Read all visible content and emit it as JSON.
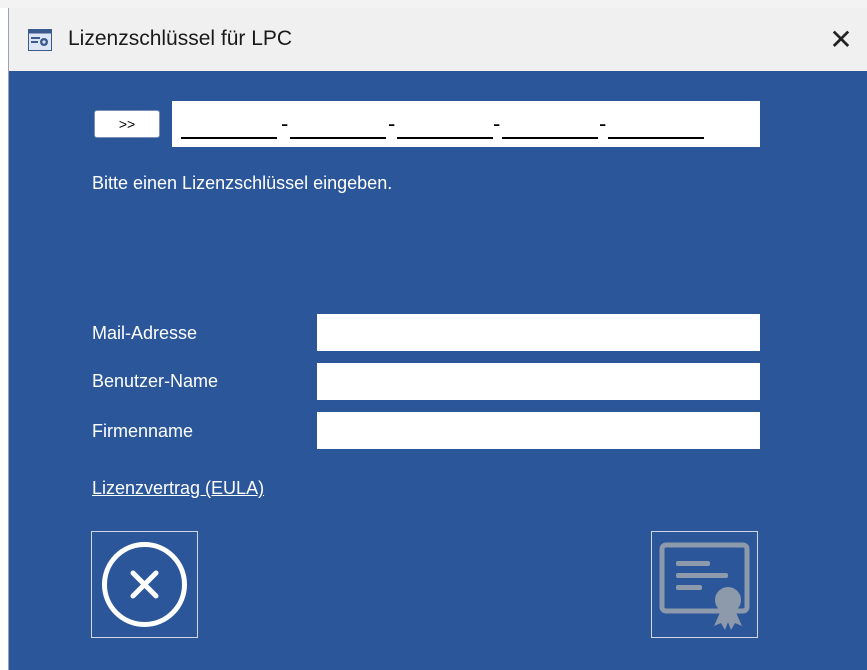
{
  "window": {
    "title": "Lizenzschlüssel für LPC",
    "close_glyph": "✕"
  },
  "license": {
    "expand_label": ">>",
    "key_value": "",
    "hint": "Bitte einen Lizenzschlüssel eingeben."
  },
  "form": {
    "mail_label": "Mail-Adresse",
    "user_label": "Benutzer-Name",
    "company_label": "Firmenname",
    "mail_value": "",
    "user_value": "",
    "company_value": ""
  },
  "eula_link": "Lizenzvertrag (EULA)",
  "icons": {
    "app": "app-license-icon",
    "cancel": "cancel-circle-x-icon",
    "certificate": "certificate-icon"
  },
  "colors": {
    "background": "#2b579a",
    "titlebar": "#f0f0f0",
    "text": "#ffffff"
  }
}
